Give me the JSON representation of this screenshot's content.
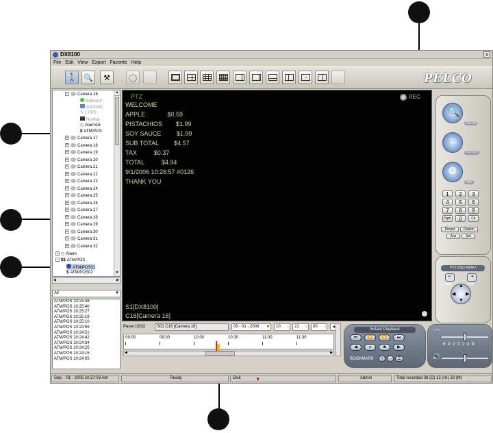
{
  "window": {
    "title": "DX8100",
    "close_glyph": "x"
  },
  "menu": [
    "File",
    "Edit",
    "View",
    "Export",
    "Favorite",
    "Help"
  ],
  "brand": "PELCO",
  "toolbar_icons": [
    "person-icon",
    "search-icon",
    "tools-icon",
    "stopwatch-icon",
    "blank-icon",
    "layout-1-icon",
    "layout-4-icon",
    "layout-9-icon",
    "layout-16-icon",
    "layout-6-icon",
    "layout-8-icon",
    "layout-10-icon",
    "layout-13-icon",
    "layout-seq-icon",
    "blank2-icon"
  ],
  "tree": {
    "camera16": {
      "label": "Camera 16",
      "children": [
        "Normal F",
        "320X24C",
        "1 FPS",
        "Normal",
        "Alarm16",
        "ATM/POS"
      ]
    },
    "cameras": [
      "Camera 17",
      "Camera 18",
      "Camera 19",
      "Camera 20",
      "Camera 21",
      "Camera 22",
      "Camera 23",
      "Camera 24",
      "Camera 25",
      "Camera 26",
      "Camera 27",
      "Camera 28",
      "Camera 29",
      "Camera 30",
      "Camera 31",
      "Camera 32"
    ],
    "groups": [
      "Alarm",
      "ATM/POS"
    ],
    "atm_items": [
      "ATM/POS01",
      "ATM/POS02"
    ]
  },
  "filter": {
    "value": "All"
  },
  "events": [
    "ATM/POS 10:25:48",
    "ATM/POS 10:25:40",
    "ATM/POS 10:25:27",
    "ATM/POS 10:25:19",
    "ATM/POS 10:25:10",
    "ATM/POS 10:24:59",
    "ATM/POS 10:24:51",
    "ATM/POS 10:24:42",
    "ATM/POS 10:24:34",
    "ATM/POS 10:24:25",
    "ATM/POS 10:24:15",
    "ATM/POS 10:24:05"
  ],
  "video": {
    "ptz": "PTZ",
    "rec": "REC",
    "lines": [
      "WELCOME",
      "APPLE             $0.59",
      "PISTACHIOS        $1.99",
      "SOY SAUCE         $1.99",
      "SUB TOTAL         $4.57",
      "TAX          $0.37",
      "TOTAL          $4.94",
      "9/1/2006 10:26:57 #0126",
      "THANK YOU"
    ],
    "site": "S1[DX8100]",
    "camera": "C16[Camera 16]"
  },
  "timeline": {
    "panel": "Panel 16/32",
    "source": "S01 C16 [Camera 16]",
    "date": "09 - 01 - 2006",
    "hour": "10",
    "minute": "21",
    "second": "00",
    "ticks": [
      "09:00",
      "09:30",
      "10:00",
      "10:30",
      "11:00",
      "11:30"
    ]
  },
  "playback": {
    "title": "Instant Playback",
    "bookmark": "BOOKMARK"
  },
  "ptz_panel": {
    "zoom": "ZOOM",
    "focus": "FOCUS",
    "iris": "IRIS",
    "keys": [
      "1",
      "2",
      "3",
      "4",
      "5",
      "6",
      "7",
      "8",
      "9",
      "Pgm",
      "0",
      "Clr"
    ],
    "preset": "Preset",
    "pattern": "Pattern",
    "aux": "Aux",
    "set": "Set",
    "osd": "PTZ OSD MENU",
    "enter": "Enter",
    "exit": "Exit"
  },
  "audio": {
    "scale": "6 4 2 0 2 4 6"
  },
  "status": {
    "datetime": "Sep. - 01 - 2006  10:27:03 AM",
    "state": "Ready",
    "disk": "Disk",
    "user": "Admin",
    "recorded": "Total recorded 38 (D) 12 (Hr) 29 (M)"
  },
  "colors": {
    "video_bg": "#020202",
    "video_text": "#d6d6a6",
    "ptz_text": "#4caf50",
    "marker": "#e8c21a",
    "playhead": "#d12a2a"
  }
}
